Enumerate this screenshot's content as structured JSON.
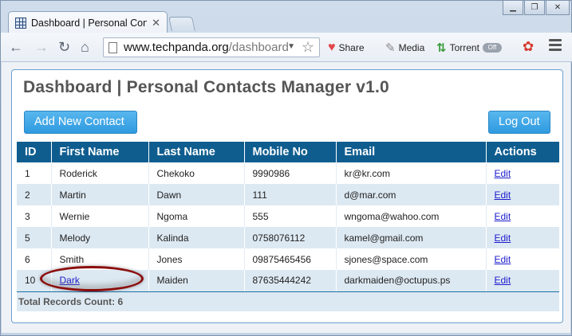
{
  "browser": {
    "tab_title": "Dashboard | Personal Conta",
    "url_host": "www.techpanda.org",
    "url_path": "/dashboard",
    "extensions": {
      "share_label": "Share",
      "media_label": "Media",
      "torrent_label": "Torrent",
      "torrent_toggle": "Off"
    }
  },
  "page": {
    "title": "Dashboard | Personal Contacts Manager v1.0",
    "add_button_label": "Add New Contact",
    "logout_button_label": "Log Out"
  },
  "table": {
    "headers": [
      "ID",
      "First Name",
      "Last Name",
      "Mobile No",
      "Email",
      "Actions"
    ],
    "rows": [
      {
        "id": "1",
        "first": "Roderick",
        "last": "Chekoko",
        "mobile": "9990986",
        "email": "kr@kr.com",
        "action": "Edit",
        "first_is_link": false
      },
      {
        "id": "2",
        "first": "Martin",
        "last": "Dawn",
        "mobile": "111",
        "email": "d@mar.com",
        "action": "Edit",
        "first_is_link": false
      },
      {
        "id": "3",
        "first": "Wernie",
        "last": "Ngoma",
        "mobile": "555",
        "email": "wngoma@wahoo.com",
        "action": "Edit",
        "first_is_link": false
      },
      {
        "id": "5",
        "first": "Melody",
        "last": "Kalinda",
        "mobile": "0758076112",
        "email": "kamel@gmail.com",
        "action": "Edit",
        "first_is_link": false
      },
      {
        "id": "6",
        "first": "Smith",
        "last": "Jones",
        "mobile": "09875465456",
        "email": "sjones@space.com",
        "action": "Edit",
        "first_is_link": false
      },
      {
        "id": "10",
        "first": "Dark",
        "last": "Maiden",
        "mobile": "87635444242",
        "email": "darkmaiden@octupus.ps",
        "action": "Edit",
        "first_is_link": true
      }
    ],
    "footer": "Total Records Count: 6"
  },
  "colors": {
    "header_bg": "#0f5d8f",
    "button_bg": "#2f9ae0",
    "annotation": "#8b0d0d"
  }
}
